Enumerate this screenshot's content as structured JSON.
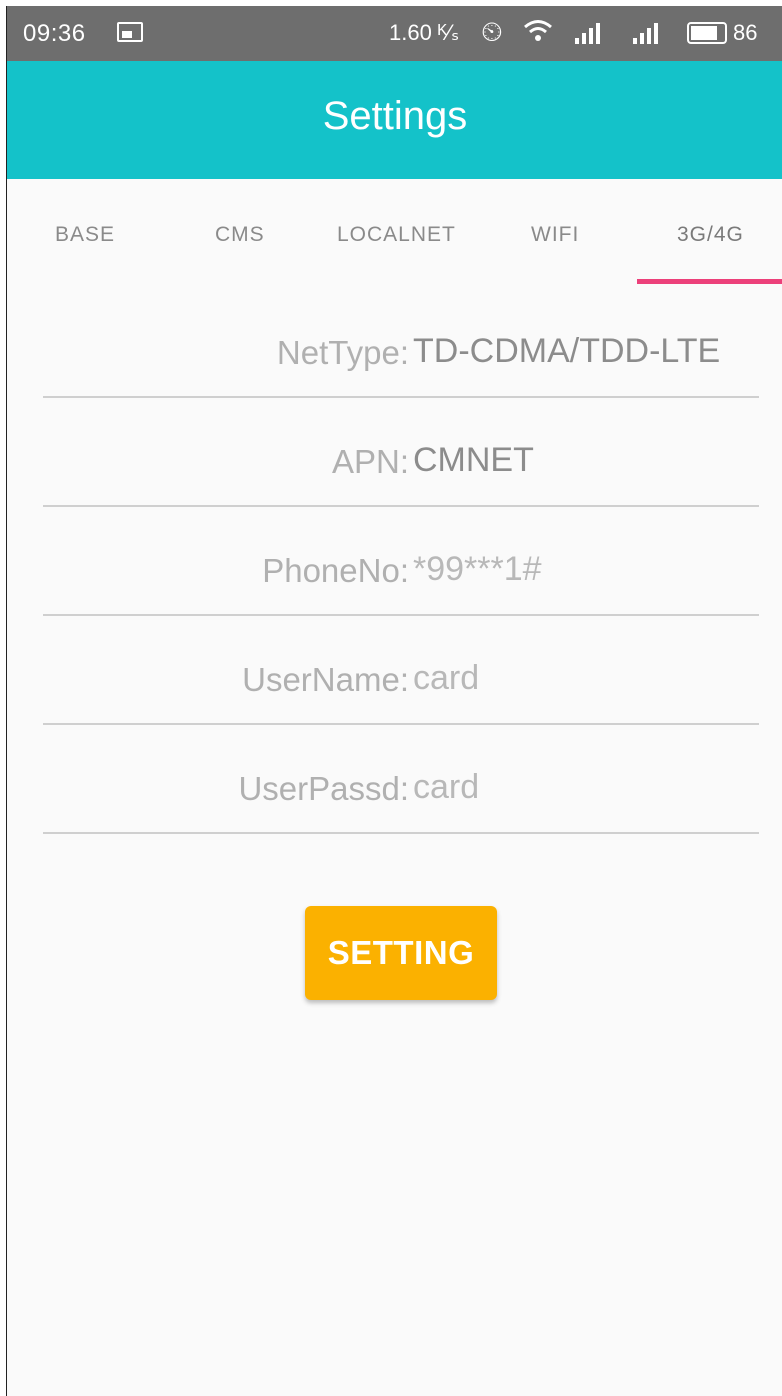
{
  "status_bar": {
    "time": "09:36",
    "net_speed": "1.60 ᴷ⁄ₛ",
    "battery": "86"
  },
  "app_bar": {
    "title": "Settings"
  },
  "tabs": [
    {
      "label": "BASE",
      "selected": false
    },
    {
      "label": "CMS",
      "selected": false
    },
    {
      "label": "LOCALNET",
      "selected": false
    },
    {
      "label": "WIFI",
      "selected": false
    },
    {
      "label": "3G/4G",
      "selected": true
    }
  ],
  "form": {
    "fields": [
      {
        "label": "NetType:",
        "value": "TD-CDMA/TDD-LTE"
      },
      {
        "label": "APN:",
        "value": "CMNET"
      },
      {
        "label": "PhoneNo:",
        "value": "*99***1#"
      },
      {
        "label": "UserName:",
        "value": "card"
      },
      {
        "label": "UserPassd:",
        "value": "card"
      }
    ]
  },
  "setting_button": {
    "label": "SETTING"
  },
  "colors": {
    "app_bar": "#14c2c9",
    "tab_indicator": "#ec407a",
    "button": "#fbb100",
    "status_bar": "#6e6e6e"
  },
  "icons": [
    "notification-image-icon",
    "alarm-icon",
    "wifi-icon",
    "signal-icon",
    "battery-icon"
  ]
}
